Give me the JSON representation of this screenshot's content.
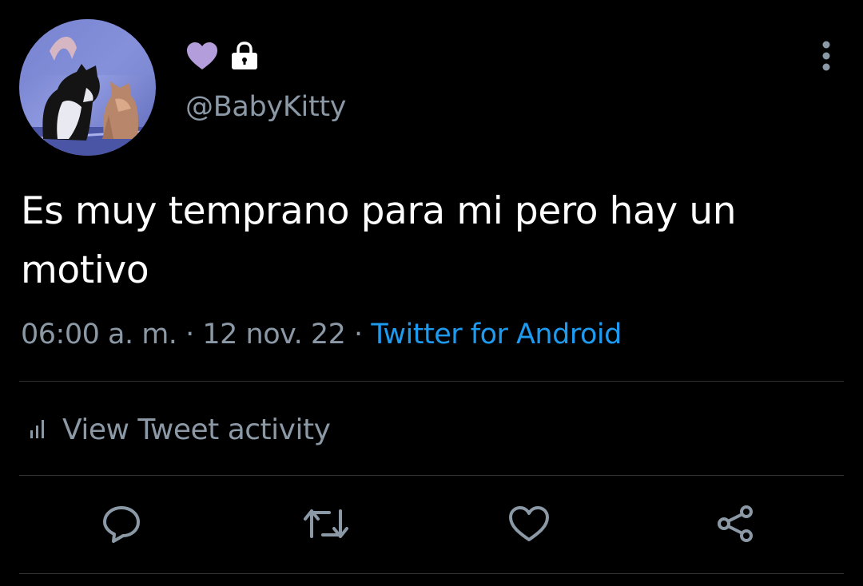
{
  "colors": {
    "background": "#000000",
    "primary_text": "#ffffff",
    "secondary_text": "#8b98a5",
    "link": "#1d9bf0",
    "heart_emoji": "#b39ddb",
    "divider": "#2f3336"
  },
  "author": {
    "display_name_icons": [
      "purple-heart-icon",
      "lock-icon"
    ],
    "handle": "@BabyKitty",
    "avatar": "avatar-two-cats-photo"
  },
  "tweet": {
    "text": "Es muy temprano para mi pero hay un motivo",
    "time": "06:00 a. m.",
    "separator": "·",
    "date": "12 nov. 22",
    "source": "Twitter for Android"
  },
  "activity": {
    "label": "View Tweet activity",
    "icon": "analytics-bars-icon"
  },
  "actions": [
    "reply-icon",
    "retweet-icon",
    "like-icon",
    "share-icon"
  ],
  "menu_icon": "more-vertical-icon"
}
